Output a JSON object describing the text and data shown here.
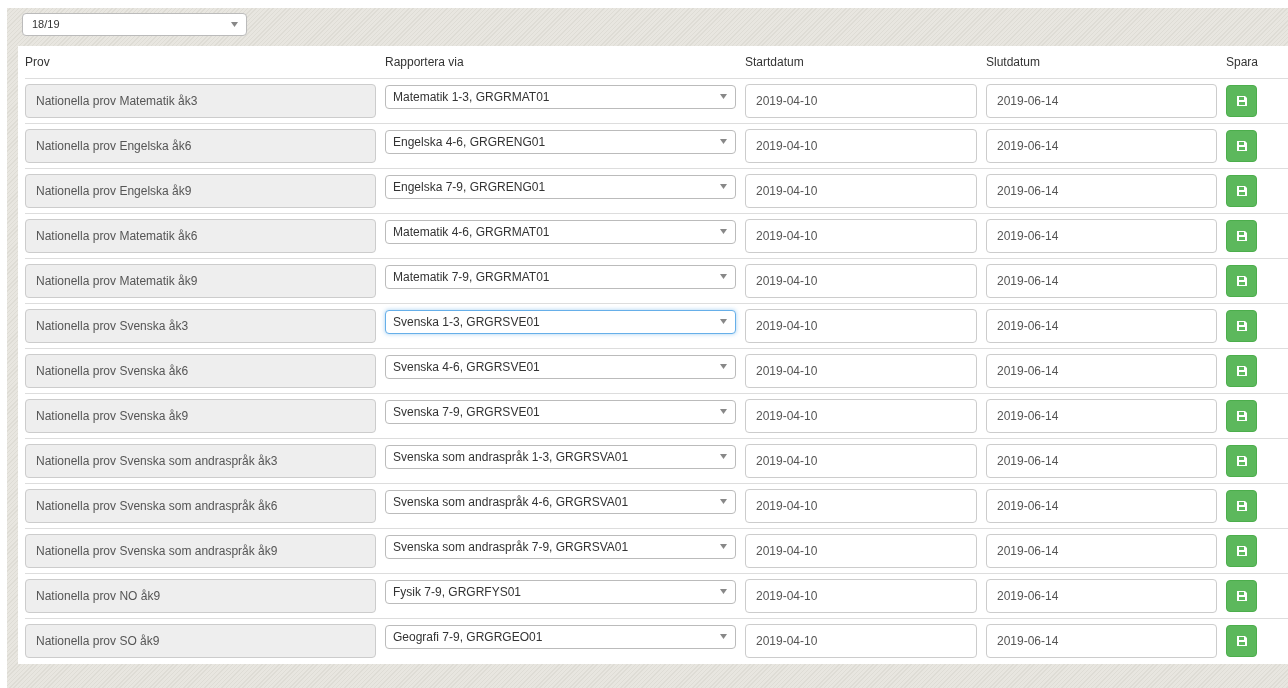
{
  "year_select": {
    "value": "18/19"
  },
  "table": {
    "columns": [
      "Prov",
      "Rapportera via",
      "Startdatum",
      "Slutdatum",
      "Spara"
    ],
    "rows": [
      {
        "prov": "Nationella prov Matematik åk3",
        "rapportera_via": "Matematik 1-3, GRGRMAT01",
        "focused": false,
        "startdatum": "2019-04-10",
        "slutdatum": "2019-06-14"
      },
      {
        "prov": "Nationella prov Engelska åk6",
        "rapportera_via": "Engelska 4-6, GRGRENG01",
        "focused": false,
        "startdatum": "2019-04-10",
        "slutdatum": "2019-06-14"
      },
      {
        "prov": "Nationella prov Engelska åk9",
        "rapportera_via": "Engelska 7-9, GRGRENG01",
        "focused": false,
        "startdatum": "2019-04-10",
        "slutdatum": "2019-06-14"
      },
      {
        "prov": "Nationella prov Matematik åk6",
        "rapportera_via": "Matematik 4-6, GRGRMAT01",
        "focused": false,
        "startdatum": "2019-04-10",
        "slutdatum": "2019-06-14"
      },
      {
        "prov": "Nationella prov Matematik åk9",
        "rapportera_via": "Matematik 7-9, GRGRMAT01",
        "focused": false,
        "startdatum": "2019-04-10",
        "slutdatum": "2019-06-14"
      },
      {
        "prov": "Nationella prov Svenska åk3",
        "rapportera_via": "Svenska 1-3, GRGRSVE01",
        "focused": true,
        "startdatum": "2019-04-10",
        "slutdatum": "2019-06-14"
      },
      {
        "prov": "Nationella prov Svenska åk6",
        "rapportera_via": "Svenska 4-6, GRGRSVE01",
        "focused": false,
        "startdatum": "2019-04-10",
        "slutdatum": "2019-06-14"
      },
      {
        "prov": "Nationella prov Svenska åk9",
        "rapportera_via": "Svenska 7-9, GRGRSVE01",
        "focused": false,
        "startdatum": "2019-04-10",
        "slutdatum": "2019-06-14"
      },
      {
        "prov": "Nationella prov Svenska som andraspråk åk3",
        "rapportera_via": "Svenska som andraspråk 1-3, GRGRSVA01",
        "focused": false,
        "startdatum": "2019-04-10",
        "slutdatum": "2019-06-14"
      },
      {
        "prov": "Nationella prov Svenska som andraspråk åk6",
        "rapportera_via": "Svenska som andraspråk 4-6, GRGRSVA01",
        "focused": false,
        "startdatum": "2019-04-10",
        "slutdatum": "2019-06-14"
      },
      {
        "prov": "Nationella prov Svenska som andraspråk åk9",
        "rapportera_via": "Svenska som andraspråk 7-9, GRGRSVA01",
        "focused": false,
        "startdatum": "2019-04-10",
        "slutdatum": "2019-06-14"
      },
      {
        "prov": "Nationella prov NO åk9",
        "rapportera_via": "Fysik 7-9, GRGRFYS01",
        "focused": false,
        "startdatum": "2019-04-10",
        "slutdatum": "2019-06-14"
      },
      {
        "prov": "Nationella prov SO åk9",
        "rapportera_via": "Geografi 7-9, GRGRGEO01",
        "focused": false,
        "startdatum": "2019-04-10",
        "slutdatum": "2019-06-14"
      }
    ]
  }
}
